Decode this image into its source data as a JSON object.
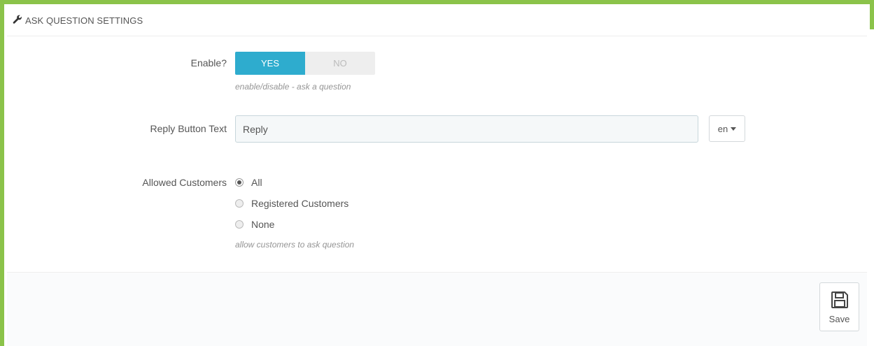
{
  "panel": {
    "title": "ASK QUESTION SETTINGS",
    "title_icon": "wrench-icon"
  },
  "enable": {
    "label": "Enable?",
    "yes_label": "YES",
    "no_label": "NO",
    "selected": "YES",
    "help": "enable/disable - ask a question"
  },
  "reply_button_text": {
    "label": "Reply Button Text",
    "value": "Reply",
    "language": "en"
  },
  "allowed_customers": {
    "label": "Allowed Customers",
    "options": [
      "All",
      "Registered Customers",
      "None"
    ],
    "selected": "All",
    "help": "allow customers to ask question"
  },
  "footer": {
    "save_label": "Save",
    "save_icon": "floppy-disk-icon"
  },
  "colors": {
    "accent_green": "#8bc34a",
    "switch_on": "#2eacce"
  }
}
